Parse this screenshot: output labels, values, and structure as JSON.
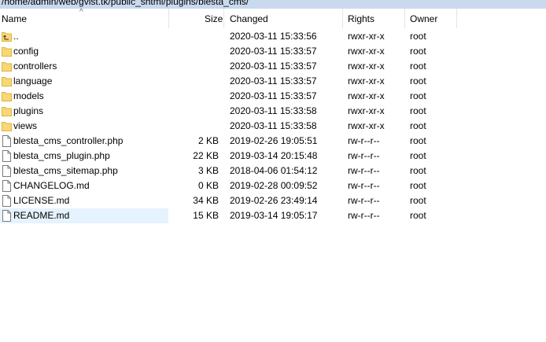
{
  "path": "/home/admin/web/gvist.tk/public_shtml/plugins/blesta_cms/",
  "columns": {
    "name": "Name",
    "size": "Size",
    "changed": "Changed",
    "rights": "Rights",
    "owner": "Owner"
  },
  "sort_indicator": "^",
  "files": [
    {
      "name": "..",
      "size": "",
      "changed": "2020-03-11 15:33:56",
      "rights": "rwxr-xr-x",
      "owner": "root",
      "icon": "parent-folder-icon"
    },
    {
      "name": "config",
      "size": "",
      "changed": "2020-03-11 15:33:57",
      "rights": "rwxr-xr-x",
      "owner": "root",
      "icon": "folder-icon"
    },
    {
      "name": "controllers",
      "size": "",
      "changed": "2020-03-11 15:33:57",
      "rights": "rwxr-xr-x",
      "owner": "root",
      "icon": "folder-icon"
    },
    {
      "name": "language",
      "size": "",
      "changed": "2020-03-11 15:33:57",
      "rights": "rwxr-xr-x",
      "owner": "root",
      "icon": "folder-icon"
    },
    {
      "name": "models",
      "size": "",
      "changed": "2020-03-11 15:33:57",
      "rights": "rwxr-xr-x",
      "owner": "root",
      "icon": "folder-icon"
    },
    {
      "name": "plugins",
      "size": "",
      "changed": "2020-03-11 15:33:58",
      "rights": "rwxr-xr-x",
      "owner": "root",
      "icon": "folder-icon"
    },
    {
      "name": "views",
      "size": "",
      "changed": "2020-03-11 15:33:58",
      "rights": "rwxr-xr-x",
      "owner": "root",
      "icon": "folder-icon"
    },
    {
      "name": "blesta_cms_controller.php",
      "size": "2 KB",
      "changed": "2019-02-26 19:05:51",
      "rights": "rw-r--r--",
      "owner": "root",
      "icon": "file-icon"
    },
    {
      "name": "blesta_cms_plugin.php",
      "size": "22 KB",
      "changed": "2019-03-14 20:15:48",
      "rights": "rw-r--r--",
      "owner": "root",
      "icon": "file-icon"
    },
    {
      "name": "blesta_cms_sitemap.php",
      "size": "3 KB",
      "changed": "2018-04-06 01:54:12",
      "rights": "rw-r--r--",
      "owner": "root",
      "icon": "file-icon"
    },
    {
      "name": "CHANGELOG.md",
      "size": "0 KB",
      "changed": "2019-02-28 00:09:52",
      "rights": "rw-r--r--",
      "owner": "root",
      "icon": "file-icon"
    },
    {
      "name": "LICENSE.md",
      "size": "34 KB",
      "changed": "2019-02-26 23:49:14",
      "rights": "rw-r--r--",
      "owner": "root",
      "icon": "file-icon"
    },
    {
      "name": "README.md",
      "size": "15 KB",
      "changed": "2019-03-14 19:05:17",
      "rights": "rw-r--r--",
      "owner": "root",
      "icon": "file-icon",
      "selected": true
    }
  ],
  "colors": {
    "path_bar": "#c9d9ee",
    "selection": "#e5f3ff",
    "folder": "#f8d775",
    "folder_dark": "#e0b443"
  }
}
